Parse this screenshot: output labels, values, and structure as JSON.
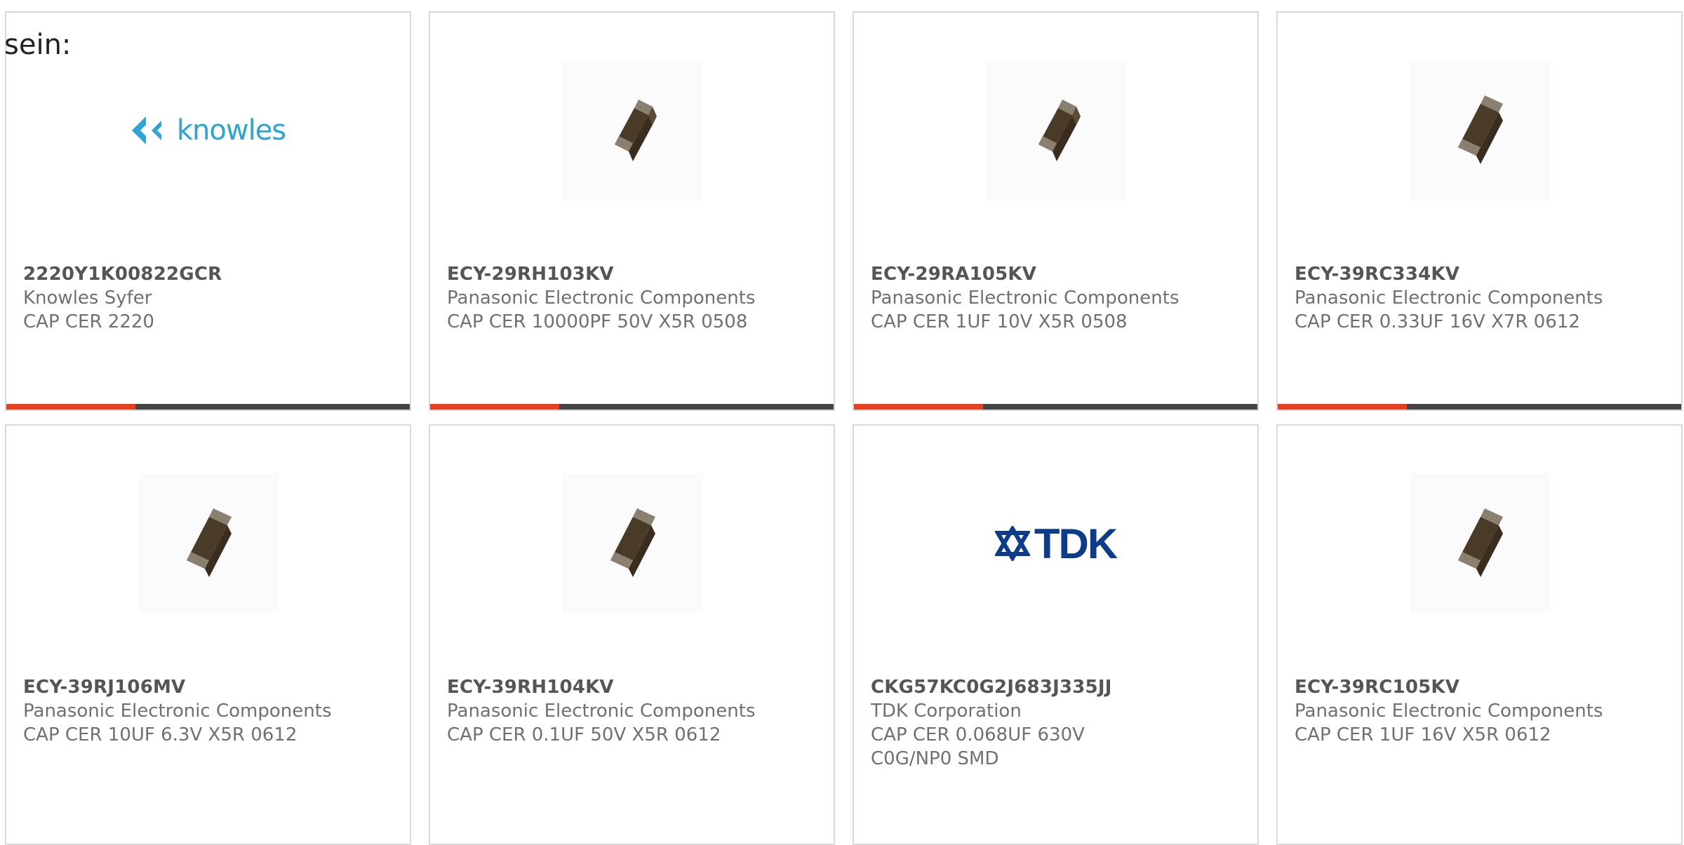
{
  "page": {
    "heading": "sein:"
  },
  "colors": {
    "accent": "#e8401c",
    "bar_track": "#444444",
    "card_border": "#d9d9d9"
  },
  "products": [
    {
      "part_number": "2220Y1K00822GCR",
      "manufacturer": "Knowles Syfer",
      "description": "CAP CER 2220",
      "image": "knowles-logo",
      "logo_text": "knowles",
      "progress": 0.32
    },
    {
      "part_number": "ECY-29RH103KV",
      "manufacturer": "Panasonic Electronic Components",
      "description": "CAP CER 10000PF 50V X5R 0508",
      "image": "chip-capacitor-icon",
      "progress": 0.32
    },
    {
      "part_number": "ECY-29RA105KV",
      "manufacturer": "Panasonic Electronic Components",
      "description": "CAP CER 1UF 10V X5R 0508",
      "image": "chip-capacitor-icon",
      "progress": 0.32
    },
    {
      "part_number": "ECY-39RC334KV",
      "manufacturer": "Panasonic Electronic Components",
      "description": "CAP CER 0.33UF 16V X7R 0612",
      "image": "chip-capacitor-icon",
      "progress": 0.32
    },
    {
      "part_number": "ECY-39RJ106MV",
      "manufacturer": "Panasonic Electronic Components",
      "description": "CAP CER 10UF 6.3V X5R 0612",
      "image": "chip-capacitor-icon"
    },
    {
      "part_number": "ECY-39RH104KV",
      "manufacturer": "Panasonic Electronic Components",
      "description": "CAP CER 0.1UF 50V X5R 0612",
      "image": "chip-capacitor-icon"
    },
    {
      "part_number": "CKG57KC0G2J683J335JJ",
      "manufacturer": "TDK Corporation",
      "description": "CAP CER 0.068UF 630V C0G/NP0 SMD",
      "image": "tdk-logo",
      "logo_text": "TDK"
    },
    {
      "part_number": "ECY-39RC105KV",
      "manufacturer": "Panasonic Electronic Components",
      "description": "CAP CER 1UF 16V X5R 0612",
      "image": "chip-capacitor-icon"
    }
  ]
}
